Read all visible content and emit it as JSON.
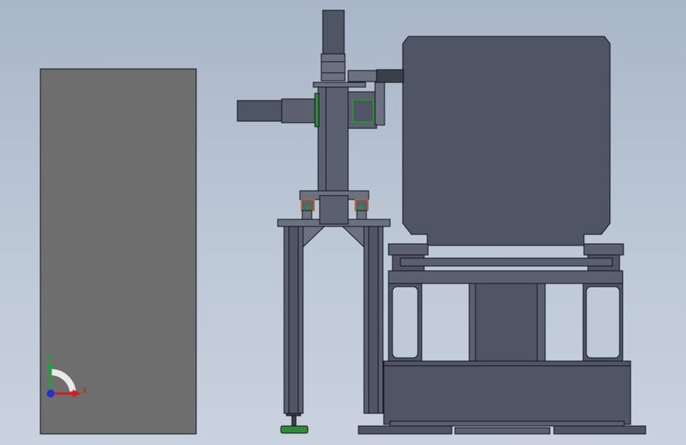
{
  "viewport": {
    "background_top": "#a9b6c8",
    "background_bottom": "#c9d2de"
  },
  "colors": {
    "body_dark": "#4f5564",
    "body_mid": "#5a6070",
    "body_light": "#6b7180",
    "outline": "#111318",
    "panel_gray": "#6e6e6e",
    "accent_green": "#2f8a3a",
    "accent_orange": "#c2651e",
    "triad_x": "#d11f1f",
    "triad_y": "#1fa33a",
    "triad_z": "#2233cc"
  },
  "triad": {
    "x_label": "X",
    "y_label": "Y"
  },
  "icons": {
    "triad": "coordinate-triad-icon"
  }
}
